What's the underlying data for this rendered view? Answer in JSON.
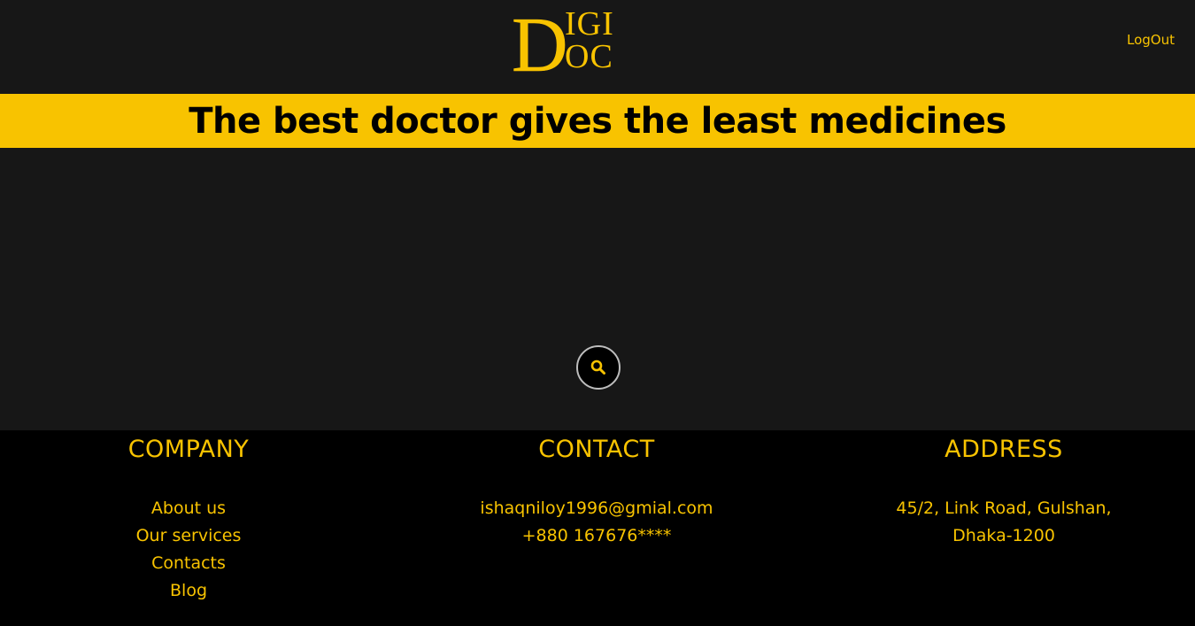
{
  "header": {
    "logo_text": "DIGI DOC",
    "logo_big_letter": "D",
    "logo_top": "IGI",
    "logo_bottom": "OC",
    "logout_label": "LogOut"
  },
  "banner": {
    "tagline": "The best doctor gives the least medicines"
  },
  "hero": {
    "search_icon": "search-icon"
  },
  "footer": {
    "company": {
      "heading": "COMPANY",
      "links": [
        "About us",
        "Our services",
        "Contacts",
        "Blog"
      ]
    },
    "contact": {
      "heading": "CONTACT",
      "email": "ishaqniloy1996@gmial.com",
      "phone": "+880 167676****"
    },
    "address": {
      "heading": "ADDRESS",
      "line1": "45/2, Link Road, Gulshan,",
      "line2": "Dhaka-1200"
    }
  },
  "colors": {
    "accent": "#f8c300",
    "background": "#171717",
    "footer": "#000000"
  }
}
